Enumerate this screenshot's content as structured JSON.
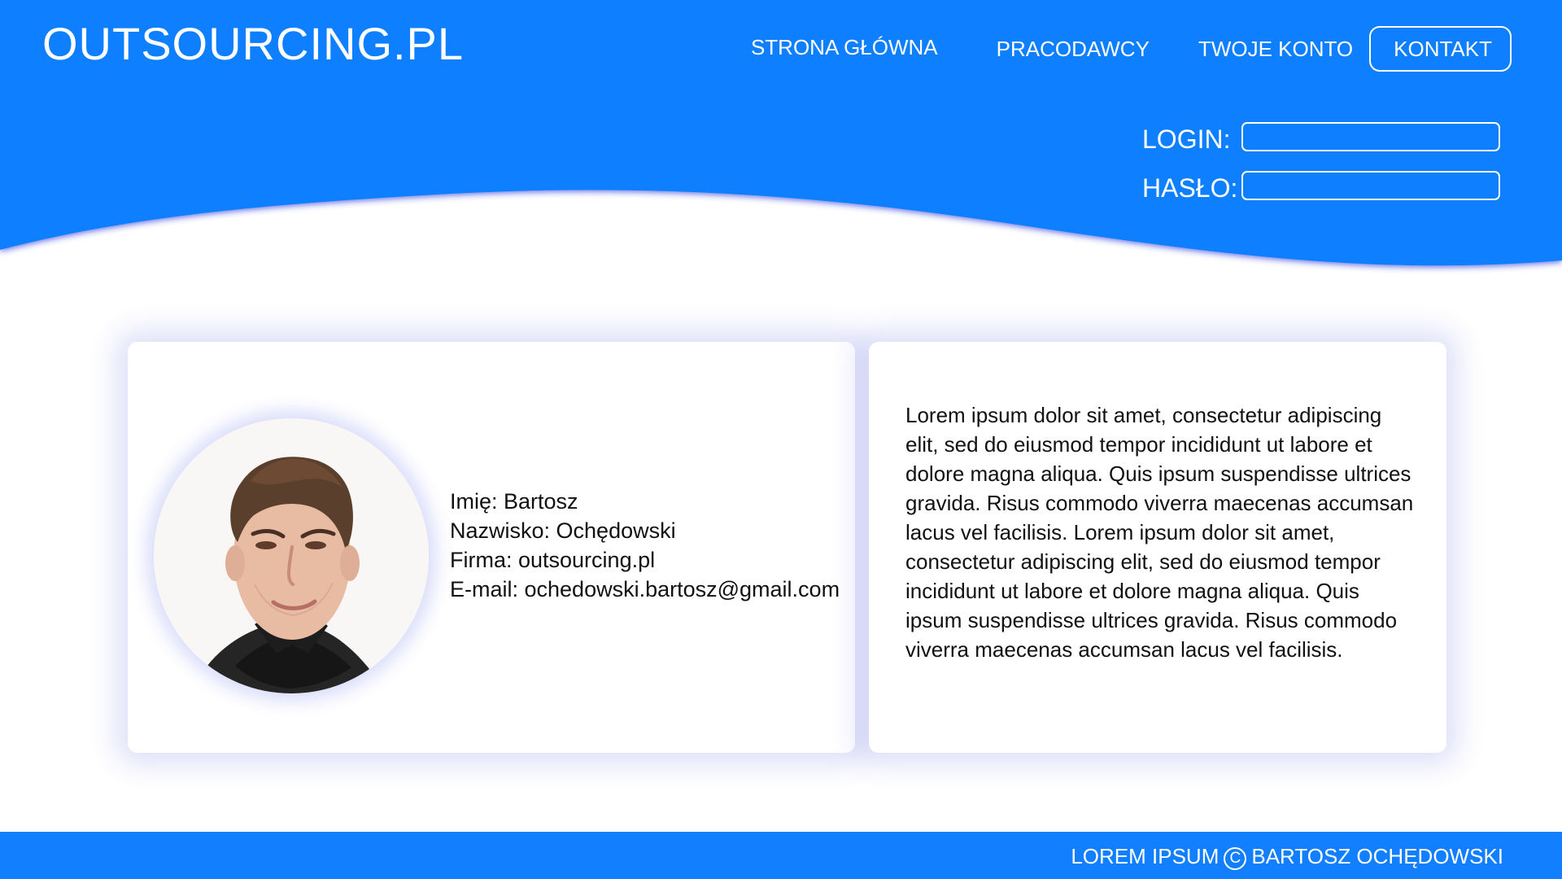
{
  "app": {
    "brand": "OUTSOURCING.PL"
  },
  "navigation": {
    "items": [
      {
        "label": "STRONA GŁÓWNA"
      },
      {
        "label": "PRACODAWCY"
      },
      {
        "label": "TWOJE KONTO"
      },
      {
        "label": "KONTAKT"
      }
    ]
  },
  "login_form": {
    "login_label": "LOGIN:",
    "login_value": "",
    "password_label": "HASŁO:",
    "password_value": ""
  },
  "profile": {
    "avatar_icon": "profile-photo",
    "lines": [
      "Imię: Bartosz",
      "Nazwisko: Ochędowski",
      "Firma: outsourcing.pl",
      "E-mail: ochedowski.bartosz@gmail.com"
    ]
  },
  "bio": {
    "text": "Lorem ipsum dolor sit amet, consectetur adipiscing elit, sed do eiusmod tempor incididunt ut labore et dolore magna aliqua. Quis ipsum suspendisse ultri­ces gravida. Risus commodo viverra maecenas ac­cumsan lacus vel facilisis. Lorem ipsum dolor sit amet, consectetur adipiscing elit, sed do eiusmod tempor incididunt ut labore et dolore magna aliqua. Quis ipsum suspendisse ultrices gravida. Risus commodo viverra maecenas accumsan lacus vel facilisis."
  },
  "footer": {
    "left_text": "LOREM IPSUM",
    "copyright_symbol": "C",
    "right_text": "BARTOSZ OCHĘDOWSKI"
  },
  "colors": {
    "primary": "#117fff",
    "wave_edge": "#2333d8",
    "text": "#111111",
    "card_shadow": "#3040d2"
  }
}
